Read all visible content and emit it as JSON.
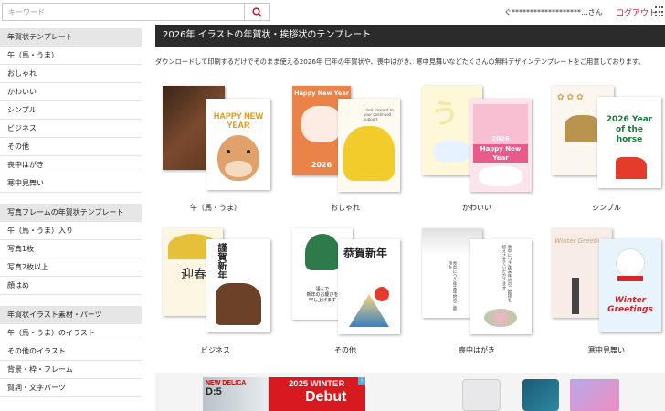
{
  "search": {
    "placeholder": "キーワード"
  },
  "header": {
    "user_text": "ぐ*******************...さん",
    "logout_label": "ログアウト"
  },
  "sidebar": {
    "sections": [
      {
        "title": "年賀状テンプレート",
        "items": [
          "午（馬・うま）",
          "おしゃれ",
          "かわいい",
          "シンプル",
          "ビジネス",
          "その他",
          "喪中はがき",
          "寒中見舞い"
        ]
      },
      {
        "title": "写真フレームの年賀状テンプレート",
        "items": [
          "午（馬・うま）入り",
          "写真1枚",
          "写真2枚以上",
          "顔はめ"
        ]
      },
      {
        "title": "年賀状イラスト素材・パーツ",
        "items": [
          "午（馬・うま）のイラスト",
          "その他のイラスト",
          "背景・枠・フレーム",
          "賀詞・文字パーツ"
        ]
      }
    ]
  },
  "main": {
    "title": "2026年 イラストの年賀状・挨拶状のテンプレート",
    "intro": "ダウンロードして印刷するだけでそのまま使える2026年 巳年の年賀状や、喪中はがき、寒中見舞いなどたくさんの無料デザインテンプレートをご用意しております。",
    "categories": [
      {
        "label": "午（馬・うま）"
      },
      {
        "label": "おしゃれ",
        "card_text": "Happy New Year",
        "year": "2026"
      },
      {
        "label": "かわいい",
        "card_text": "Happy New Year",
        "year": "2026"
      },
      {
        "label": "シンプル",
        "card_text": "2026 Year of the horse"
      },
      {
        "label": "ビジネス"
      },
      {
        "label": "その他"
      },
      {
        "label": "喪中はがき"
      },
      {
        "label": "寒中見舞い",
        "card_text": "Winter Greetings"
      }
    ],
    "card1_text": "HAPPY NEW YEAR"
  },
  "ad": {
    "brand": "NEW DELICA",
    "model": "D:5",
    "title": "2025 WINTER",
    "subtitle": "Debut",
    "info": "i"
  },
  "colors": {
    "accent": "#d01a2b",
    "title_bar": "#2b2b2b",
    "section_bg": "#e6e6e6"
  }
}
